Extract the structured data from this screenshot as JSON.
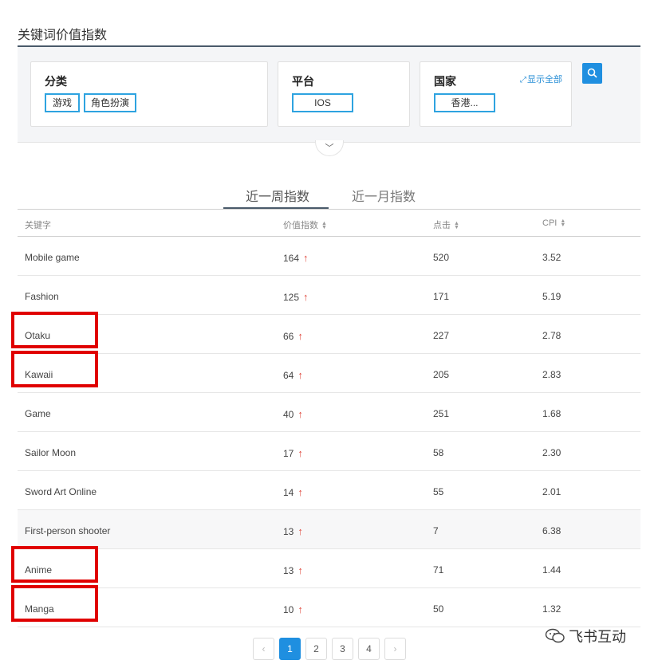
{
  "page_title": "关键词价值指数",
  "filters": {
    "category": {
      "title": "分类",
      "chips": [
        "游戏",
        "角色扮演"
      ]
    },
    "platform": {
      "title": "平台",
      "chips": [
        "IOS"
      ]
    },
    "country": {
      "title": "国家",
      "chips": [
        "香港..."
      ],
      "show_all": "显示全部",
      "show_all_icon": "link-arrow-icon"
    },
    "search_icon": "search-icon",
    "expand_icon": "chevron-down-icon"
  },
  "tabs": [
    "近一周指数",
    "近一月指数"
  ],
  "active_tab": 0,
  "table": {
    "headers": [
      "关键字",
      "价值指数",
      "点击",
      "CPI"
    ],
    "rows": [
      {
        "keyword": "Mobile game",
        "index": "164",
        "clicks": "520",
        "cpi": "3.52"
      },
      {
        "keyword": "Fashion",
        "index": "125",
        "clicks": "171",
        "cpi": "5.19"
      },
      {
        "keyword": "Otaku",
        "index": "66",
        "clicks": "227",
        "cpi": "2.78"
      },
      {
        "keyword": "Kawaii",
        "index": "64",
        "clicks": "205",
        "cpi": "2.83"
      },
      {
        "keyword": "Game",
        "index": "40",
        "clicks": "251",
        "cpi": "1.68"
      },
      {
        "keyword": "Sailor Moon",
        "index": "17",
        "clicks": "58",
        "cpi": "2.30"
      },
      {
        "keyword": "Sword Art Online",
        "index": "14",
        "clicks": "55",
        "cpi": "2.01"
      },
      {
        "keyword": "First-person shooter",
        "index": "13",
        "clicks": "7",
        "cpi": "6.38"
      },
      {
        "keyword": "Anime",
        "index": "13",
        "clicks": "71",
        "cpi": "1.44"
      },
      {
        "keyword": "Manga",
        "index": "10",
        "clicks": "50",
        "cpi": "1.32"
      }
    ],
    "trend_symbol": "↑",
    "highlighted_keywords": [
      "Otaku",
      "Kawaii",
      "Anime",
      "Manga"
    ]
  },
  "pagination": {
    "prev": "‹",
    "pages": [
      "1",
      "2",
      "3",
      "4"
    ],
    "next": "›",
    "current": "1"
  },
  "watermark": "飞书互动",
  "colors": {
    "accent": "#1f8fe0",
    "chip_border": "#2ea3e0",
    "trend_up": "#e04a3f",
    "highlight": "#e00000"
  }
}
